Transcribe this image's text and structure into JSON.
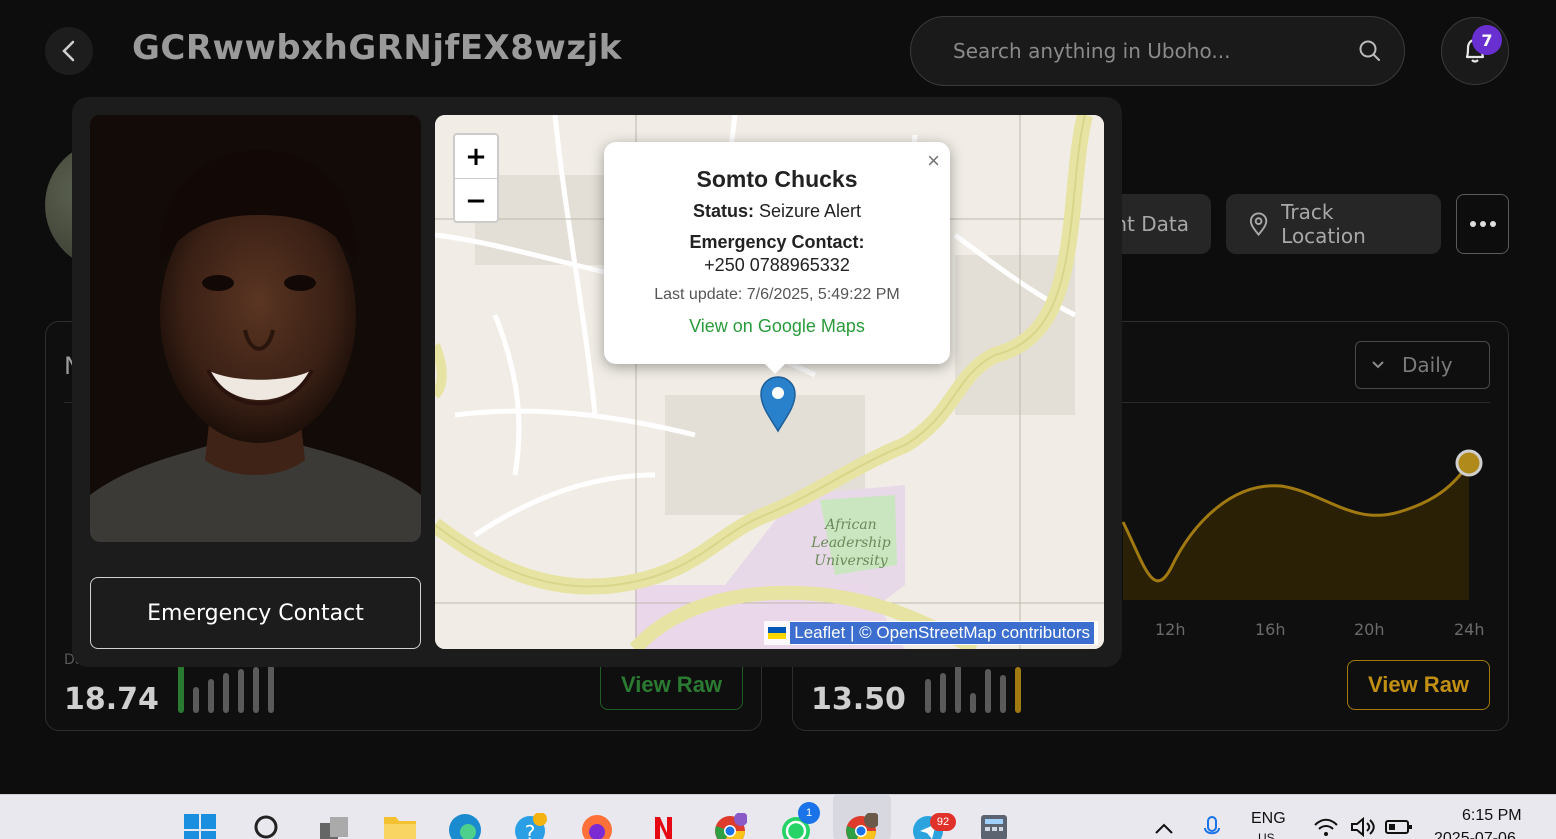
{
  "header": {
    "title": "GCRwwbxhGRNjfEX8wzjk",
    "search_placeholder": "Search anything in Uboho...",
    "notification_count": "7"
  },
  "actions": {
    "data_label": "nt Data",
    "track_label": "Track Location"
  },
  "cards": {
    "left": {
      "letter": "N",
      "value": "18.74",
      "view_raw": "View Raw",
      "bars_color": "#2b7a32"
    },
    "right": {
      "select": "Daily",
      "ticks": [
        "12h",
        "16h",
        "20h",
        "24h"
      ],
      "value": "13.50",
      "view_raw": "View Raw",
      "accent": "#c08f13"
    }
  },
  "modal": {
    "emergency_button": "Emergency Contact",
    "popup": {
      "name": "Somto Chucks",
      "status_label": "Status:",
      "status_value": "Seizure Alert",
      "contact_label": "Emergency Contact:",
      "phone": "+250 0788965332",
      "last_update": "Last update: 7/6/2025, 5:49:22 PM",
      "link": "View on Google Maps",
      "close": "×"
    },
    "map": {
      "zoom_in": "+",
      "zoom_out": "−",
      "place_label": [
        "African",
        "Leadership",
        "University"
      ],
      "attribution_leaflet": "Leaflet",
      "attribution_rest": "| © OpenStreetMap contributors"
    }
  },
  "taskbar": {
    "lang": "ENG",
    "region": "US",
    "time": "6:15 PM",
    "date": "2025-07-06",
    "badges": {
      "whatsapp": "1",
      "telegram": "92"
    }
  }
}
